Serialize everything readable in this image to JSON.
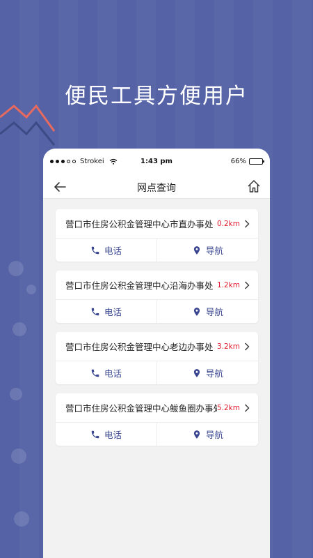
{
  "promo": {
    "title": "便民工具方便用户"
  },
  "status_bar": {
    "carrier": "Strokei",
    "time": "1:43 pm",
    "battery": "66%",
    "battery_level": 0.66
  },
  "nav": {
    "title": "网点查询"
  },
  "offices": [
    {
      "name": "营口市住房公积金管理中心市直办事处",
      "distance": "0.2km",
      "phone_label": "电话",
      "nav_label": "导航"
    },
    {
      "name": "营口市住房公积金管理中心沿海办事处",
      "distance": "1.2km",
      "phone_label": "电话",
      "nav_label": "导航"
    },
    {
      "name": "营口市住房公积金管理中心老边办事处",
      "distance": "3.2km",
      "phone_label": "电话",
      "nav_label": "导航"
    },
    {
      "name": "营口市住房公积金管理中心鲅鱼圈办事处",
      "distance": "5.2km",
      "phone_label": "电话",
      "nav_label": "导航"
    }
  ],
  "colors": {
    "background": "#5563a6",
    "accent": "#3a4790",
    "distance": "#e0182d"
  },
  "icons": [
    "back-arrow-icon",
    "home-icon",
    "chevron-right-icon",
    "phone-icon",
    "location-pin-icon",
    "wifi-icon",
    "battery-icon"
  ]
}
